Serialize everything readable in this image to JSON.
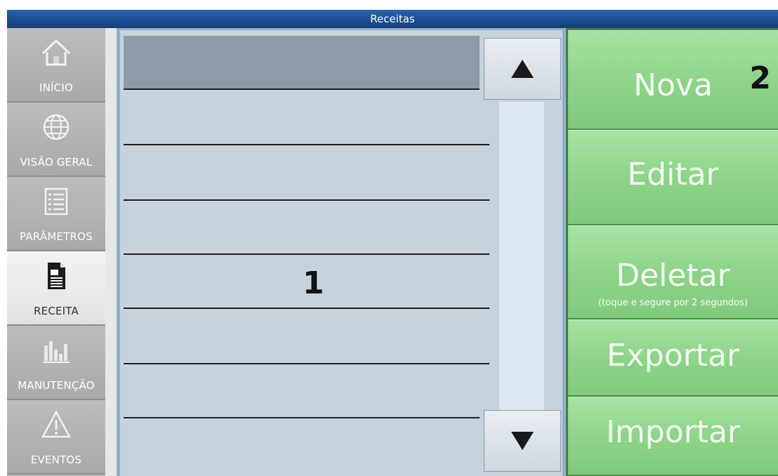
{
  "window": {
    "title": "Receitas"
  },
  "sidebar": {
    "items": [
      {
        "label": "INÍCIO",
        "icon": "home-icon",
        "active": false
      },
      {
        "label": "VISÃO GERAL",
        "icon": "globe-icon",
        "active": false
      },
      {
        "label": "PARÂMETROS",
        "icon": "list-icon",
        "active": false
      },
      {
        "label": "RECEITA",
        "icon": "document-icon",
        "active": true
      },
      {
        "label": "MANUTENÇÃO",
        "icon": "bar-chart-icon",
        "active": false
      },
      {
        "label": "EVENTOS",
        "icon": "warning-icon",
        "active": false
      }
    ]
  },
  "list": {
    "marker": "1",
    "row_count": 7
  },
  "scrollbar": {
    "up_icon": "arrow-up-icon",
    "down_icon": "arrow-down-icon"
  },
  "actions": {
    "marker": "2",
    "new_label": "Nova",
    "edit_label": "Editar",
    "delete_label": "Deletar",
    "delete_hint": "(toque e segure por 2 segundos)",
    "export_label": "Exportar",
    "import_label": "Importar"
  },
  "colors": {
    "title_bar": "#1a4f93",
    "action_green": "#8fd58b",
    "list_background": "#c7d3dc",
    "selected_row": "#8e9aa7"
  }
}
